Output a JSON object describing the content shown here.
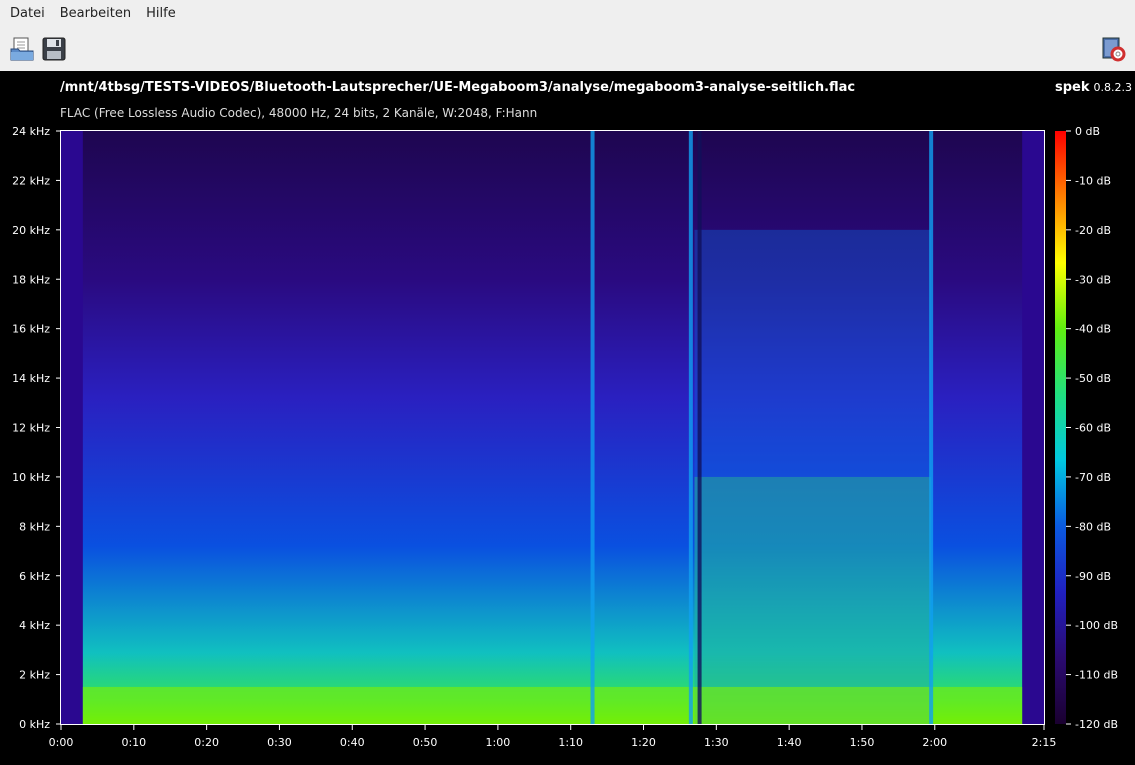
{
  "menu": {
    "items": [
      "Datei",
      "Bearbeiten",
      "Hilfe"
    ]
  },
  "toolbar": {
    "open_icon": "open-file-icon",
    "save_icon": "save-icon",
    "about_icon": "about-icon"
  },
  "header": {
    "file_path": "/mnt/4tbsg/TESTS-VIDEOS/Bluetooth-Lautsprecher/UE-Megaboom3/analyse/megaboom3-analyse-seitlich.flac",
    "app_name": "spek",
    "app_version": "0.8.2.3",
    "info": "FLAC (Free Lossless Audio Codec), 48000 Hz, 24 bits, 2 Kanäle, W:2048, F:Hann"
  },
  "chart_data": {
    "type": "heatmap",
    "title": "",
    "xlabel": "",
    "ylabel": "",
    "x_ticks": [
      "0:00",
      "0:10",
      "0:20",
      "0:30",
      "0:40",
      "0:50",
      "1:00",
      "1:10",
      "1:20",
      "1:30",
      "1:40",
      "1:50",
      "2:00",
      "2:15"
    ],
    "x_tick_seconds": [
      0,
      10,
      20,
      30,
      40,
      50,
      60,
      70,
      80,
      90,
      100,
      110,
      120,
      135
    ],
    "x_range_seconds": [
      0,
      135
    ],
    "y_ticks": [
      "0 kHz",
      "2 kHz",
      "4 kHz",
      "6 kHz",
      "8 kHz",
      "10 kHz",
      "12 kHz",
      "14 kHz",
      "16 kHz",
      "18 kHz",
      "20 kHz",
      "22 kHz",
      "24 kHz"
    ],
    "y_tick_khz": [
      0,
      2,
      4,
      6,
      8,
      10,
      12,
      14,
      16,
      18,
      20,
      22,
      24
    ],
    "y_range_khz": [
      0,
      24
    ],
    "colorbar_ticks": [
      "0 dB",
      "-10 dB",
      "-20 dB",
      "-30 dB",
      "-40 dB",
      "-50 dB",
      "-60 dB",
      "-70 dB",
      "-80 dB",
      "-90 dB",
      "-100 dB",
      "-110 dB",
      "-120 dB"
    ],
    "colorbar_range_db": [
      -120,
      0
    ],
    "colormap": [
      "#1a0030",
      "#2a0a70",
      "#2020c0",
      "#0a5ae0",
      "#00c8e0",
      "#20e080",
      "#60ee10",
      "#ffff00",
      "#ff8000",
      "#ff0000"
    ]
  }
}
